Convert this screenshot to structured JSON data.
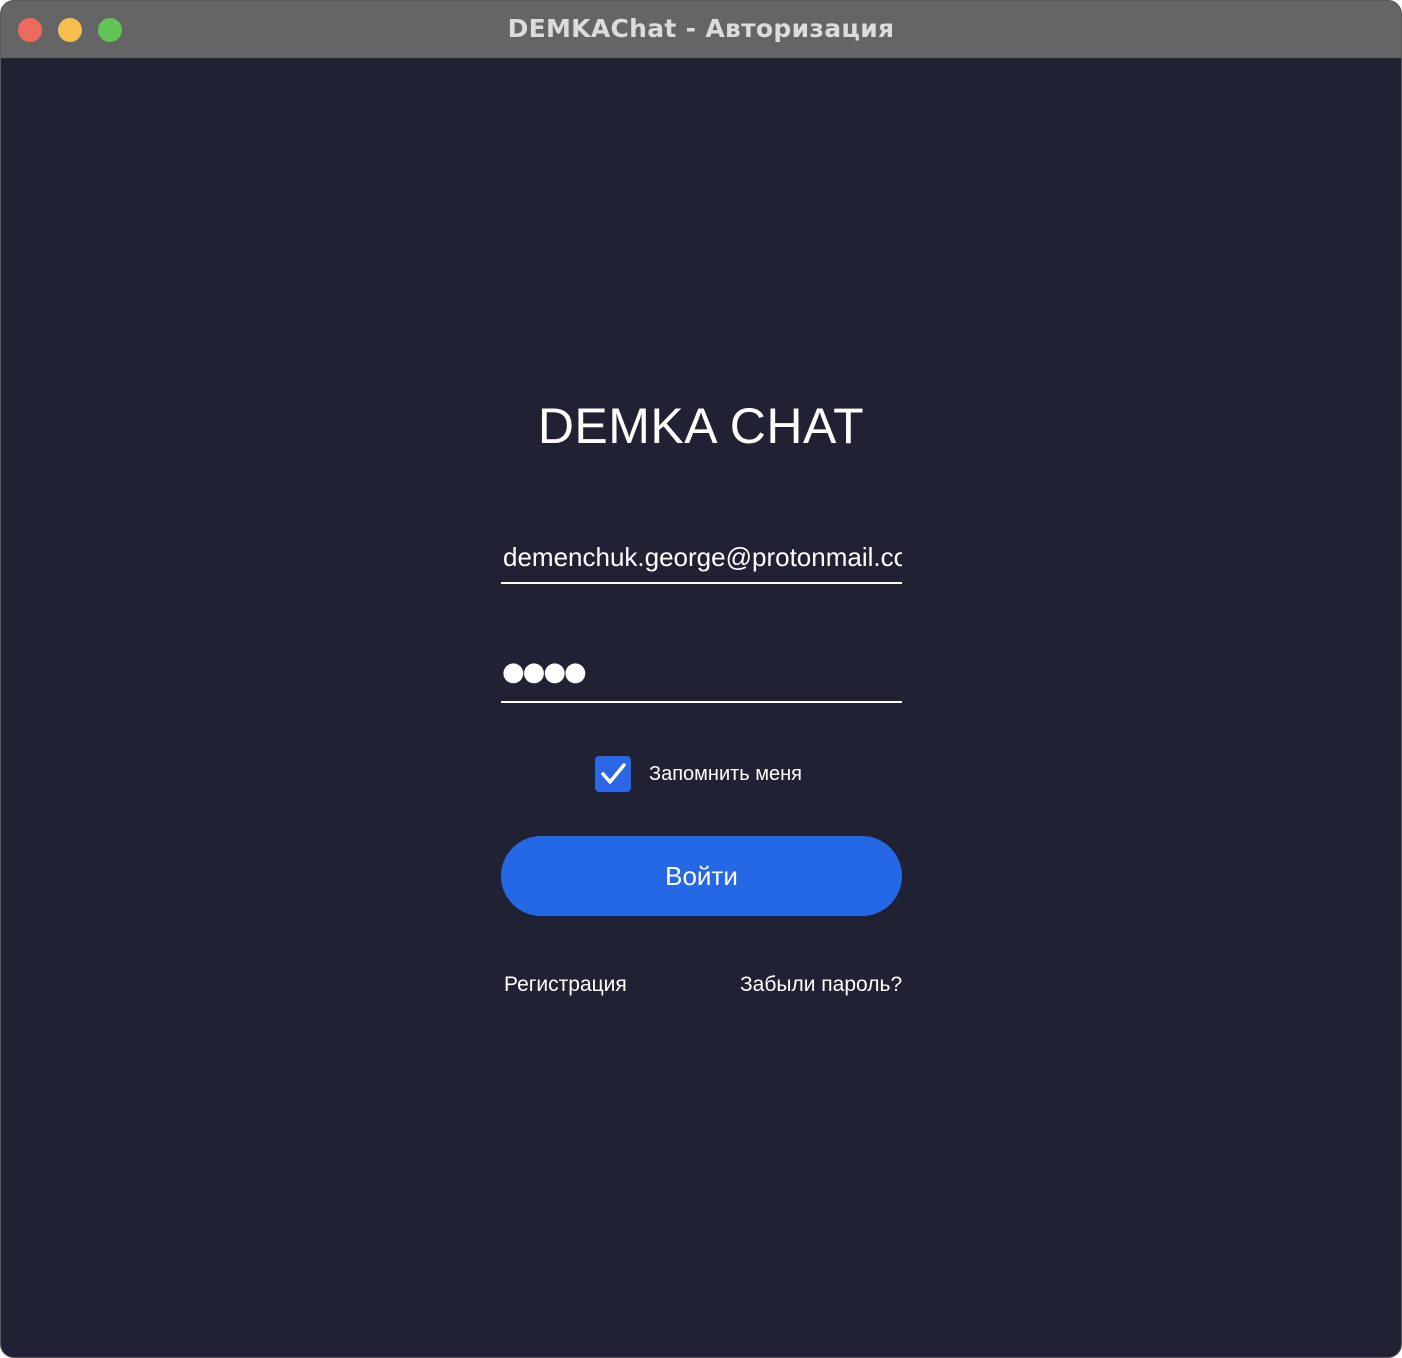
{
  "window": {
    "title": "DEMKAChat - Авторизация"
  },
  "login": {
    "app_title": "DEMKA CHAT",
    "email_value": "demenchuk.george@protonmail.com",
    "password_masked": "●●●●",
    "remember_me_label": "Запомнить меня",
    "remember_me_checked": true,
    "login_button_label": "Войти",
    "register_link": "Регистрация",
    "forgot_password_link": "Забыли пароль?"
  },
  "icons": {
    "close": "close-icon",
    "minimize": "minimize-icon",
    "zoom": "zoom-icon",
    "checkmark": "checkmark-icon"
  },
  "colors": {
    "background": "#202234",
    "titlebar": "#656565",
    "accent": "#2568e6",
    "close": "#ed6a5e",
    "minimize": "#f5bf4f",
    "zoom": "#61c554"
  }
}
